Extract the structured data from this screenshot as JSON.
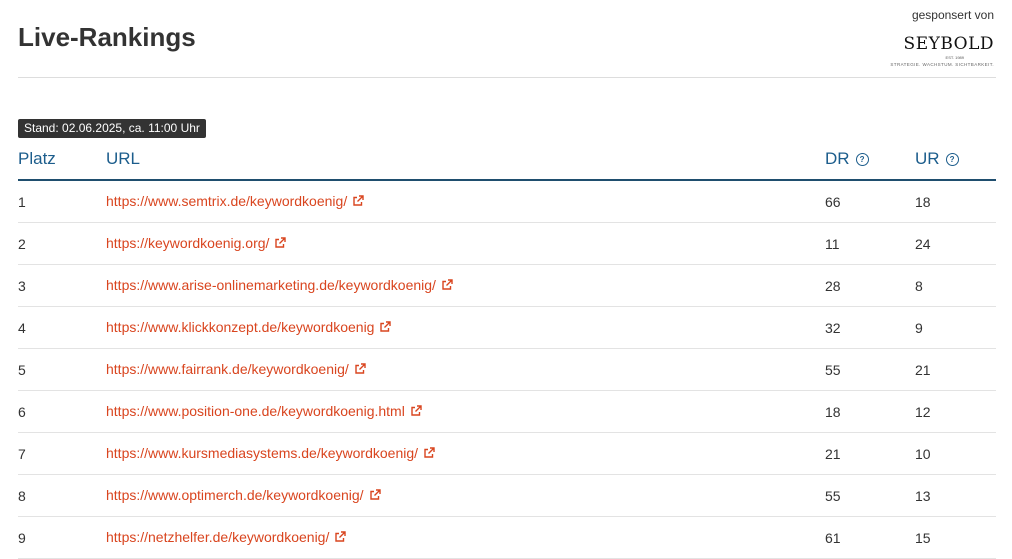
{
  "header": {
    "title": "Live-Rankings"
  },
  "sponsor": {
    "label": "gesponsert von",
    "logo_name": "SEYBOLD",
    "logo_est": "EST. 1989",
    "logo_tagline": "STRATEGIE. WACHSTUM. SICHTBARKEIT."
  },
  "stand": "Stand: 02.06.2025, ca. 11:00 Uhr",
  "table": {
    "columns": {
      "platz": "Platz",
      "url": "URL",
      "dr": "DR",
      "ur": "UR"
    },
    "rows": [
      {
        "platz": "1",
        "url": "https://www.semtrix.de/keywordkoenig/",
        "dr": "66",
        "ur": "18"
      },
      {
        "platz": "2",
        "url": "https://keywordkoenig.org/",
        "dr": "11",
        "ur": "24"
      },
      {
        "platz": "3",
        "url": "https://www.arise-onlinemarketing.de/keywordkoenig/",
        "dr": "28",
        "ur": "8"
      },
      {
        "platz": "4",
        "url": "https://www.klickkonzept.de/keywordkoenig",
        "dr": "32",
        "ur": "9"
      },
      {
        "platz": "5",
        "url": "https://www.fairrank.de/keywordkoenig/",
        "dr": "55",
        "ur": "21"
      },
      {
        "platz": "6",
        "url": "https://www.position-one.de/keywordkoenig.html",
        "dr": "18",
        "ur": "12"
      },
      {
        "platz": "7",
        "url": "https://www.kursmediasystems.de/keywordkoenig/",
        "dr": "21",
        "ur": "10"
      },
      {
        "platz": "8",
        "url": "https://www.optimerch.de/keywordkoenig/",
        "dr": "55",
        "ur": "13"
      },
      {
        "platz": "9",
        "url": "https://netzhelfer.de/keywordkoenig/",
        "dr": "61",
        "ur": "15"
      }
    ]
  },
  "icons": {
    "help": "question-circle-icon",
    "external": "external-link-icon"
  },
  "colors": {
    "link": "#d9451f",
    "header_text": "#1c5d8c",
    "header_border": "#1f4e6e",
    "badge_bg": "#333333"
  }
}
